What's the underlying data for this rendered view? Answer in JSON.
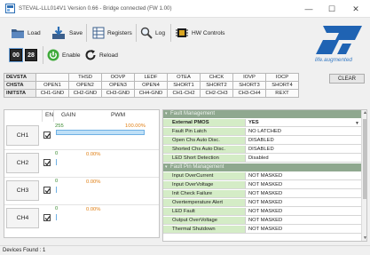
{
  "window": {
    "title": "STEVAL-LLL014V1 Version 0.66 - Bridge connected (FW 1.00)",
    "minimize": "—",
    "maximize": "☐",
    "close": "✕"
  },
  "toolbar": {
    "load": "Load",
    "save": "Save",
    "registers": "Registers",
    "log": "Log",
    "hw_controls": "HW Controls",
    "addr_a": "00",
    "addr_b": "28",
    "enable": "Enable",
    "reload": "Reload"
  },
  "brand": {
    "tagline": "life.augmented",
    "color": "#1f63b3"
  },
  "status_table": {
    "rows": [
      {
        "label": "DEVSTA",
        "cells": [
          "",
          "THSD",
          "OOVP",
          "LEDF",
          "OTEA",
          "CHCK",
          "IOVP",
          "IOCP"
        ]
      },
      {
        "label": "CHSTA",
        "cells": [
          "OPEN1",
          "OPEN2",
          "OPEN3",
          "OPEN4",
          "SHORT1",
          "SHORT2",
          "SHORT3",
          "SHORT4"
        ]
      },
      {
        "label": "INITSTA",
        "cells": [
          "CH1-GND",
          "CH2-GND",
          "CH3-GND",
          "CH4-GND",
          "CH1-CH2",
          "CH2-CH3",
          "CH3-CH4",
          "REXT"
        ]
      }
    ],
    "clear": "CLEAR"
  },
  "channels": {
    "headers": {
      "en": "EN",
      "gain": "GAIN",
      "pwm": "PWM"
    },
    "items": [
      {
        "label": "CH1",
        "enabled": true,
        "gain": "255",
        "pwm_text": "100.00%",
        "pwm": 1.0
      },
      {
        "label": "CH2",
        "enabled": true,
        "gain": "0",
        "pwm_text": "0.00%",
        "pwm": 0.0
      },
      {
        "label": "CH3",
        "enabled": true,
        "gain": "0",
        "pwm_text": "0.00%",
        "pwm": 0.0
      },
      {
        "label": "CH4",
        "enabled": true,
        "gain": "0",
        "pwm_text": "0.00%",
        "pwm": 0.0
      }
    ]
  },
  "properties": {
    "sections": [
      {
        "title": "Fault Management",
        "rows": [
          {
            "name": "External PMOS",
            "value": "YES",
            "dropdown": true,
            "bold": true
          },
          {
            "name": "Fault Pin Latch",
            "value": "NO LATCHED"
          },
          {
            "name": "Open Chs Auto Disc.",
            "value": "DISABLED"
          },
          {
            "name": "Shorted Chs Auto Disc.",
            "value": "DISABLED"
          },
          {
            "name": "LED Short Detection",
            "value": "Disabled"
          }
        ]
      },
      {
        "title": "Fault Pin Management",
        "rows": [
          {
            "name": "Input OverCurrent",
            "value": "NOT MASKED"
          },
          {
            "name": "Input OverVoltage",
            "value": "NOT MASKED"
          },
          {
            "name": "Init Check Failure",
            "value": "NOT MASKED"
          },
          {
            "name": "Overtemperature Alert",
            "value": "NOT MASKED"
          },
          {
            "name": "LED Fault",
            "value": "NOT MASKED"
          },
          {
            "name": "Output OverVoltage",
            "value": "NOT MASKED"
          },
          {
            "name": "Thermal Shutdown",
            "value": "NOT MASKED"
          }
        ]
      }
    ]
  },
  "statusbar": {
    "text": "Devices Found : 1"
  }
}
